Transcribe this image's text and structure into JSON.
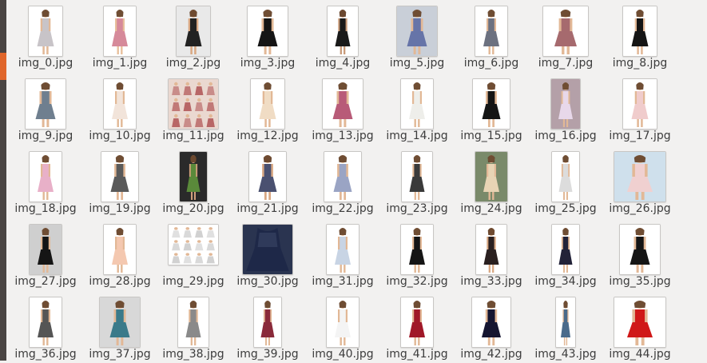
{
  "window": {
    "accent_color": "#e0662b",
    "launcher_color": "#4a4543",
    "background": "#f2f1f0"
  },
  "files": [
    {
      "name": "img_0.jpg",
      "bg": "#ffffff",
      "dress": "#c8c4c8",
      "skin": "#e2b896"
    },
    {
      "name": "img_1.jpg",
      "bg": "#ffffff",
      "dress": "#d68a9a",
      "skin": "#e8c09c"
    },
    {
      "name": "img_2.jpg",
      "bg": "#e9e9e9",
      "dress": "#222222",
      "skin": "#d9a883"
    },
    {
      "name": "img_3.jpg",
      "bg": "#ffffff",
      "dress": "#151515",
      "skin": "#e2b896"
    },
    {
      "name": "img_4.jpg",
      "bg": "#ffffff",
      "dress": "#1a1a1a",
      "skin": "#c89a78"
    },
    {
      "name": "img_5.jpg",
      "bg": "#c9cfd8",
      "dress": "#6674a8",
      "skin": "#e2b896"
    },
    {
      "name": "img_6.jpg",
      "bg": "#ffffff",
      "dress": "#6c7180",
      "skin": "#e2b896"
    },
    {
      "name": "img_7.jpg",
      "bg": "#ffffff",
      "dress": "#a66a6e",
      "skin": "#e2b896"
    },
    {
      "name": "img_8.jpg",
      "bg": "#ffffff",
      "dress": "#151515",
      "skin": "#e2b896"
    },
    {
      "name": "img_9.jpg",
      "bg": "#ffffff",
      "dress": "#6f7f8f",
      "skin": "#e2b896"
    },
    {
      "name": "img_10.jpg",
      "bg": "#ffffff",
      "dress": "#f2e4da",
      "skin": "#e2b896"
    },
    {
      "name": "img_11.jpg",
      "bg": "#ead8d0",
      "dress": "#b35a5a",
      "skin": "#e2b896"
    },
    {
      "name": "img_12.jpg",
      "bg": "#ffffff",
      "dress": "#f0dcc4",
      "skin": "#e2b896"
    },
    {
      "name": "img_13.jpg",
      "bg": "#ffffff",
      "dress": "#b85b78",
      "skin": "#e2b896"
    },
    {
      "name": "img_14.jpg",
      "bg": "#ffffff",
      "dress": "#eeeeea",
      "skin": "#e2b896"
    },
    {
      "name": "img_15.jpg",
      "bg": "#ffffff",
      "dress": "#151515",
      "skin": "#e2b896"
    },
    {
      "name": "img_16.jpg",
      "bg": "#b4a0a8",
      "dress": "#e8d8ea",
      "skin": "#e2b896"
    },
    {
      "name": "img_17.jpg",
      "bg": "#ffffff",
      "dress": "#f0cccc",
      "skin": "#e2b896"
    },
    {
      "name": "img_18.jpg",
      "bg": "#ffffff",
      "dress": "#e8b0c8",
      "skin": "#e2b896"
    },
    {
      "name": "img_19.jpg",
      "bg": "#ffffff",
      "dress": "#5a5a5a",
      "skin": "#e2b896"
    },
    {
      "name": "img_20.jpg",
      "bg": "#2a2a2a",
      "dress": "#5a8a3a",
      "skin": "#d2a07c"
    },
    {
      "name": "img_21.jpg",
      "bg": "#ffffff",
      "dress": "#4a5070",
      "skin": "#d9a883"
    },
    {
      "name": "img_22.jpg",
      "bg": "#ffffff",
      "dress": "#9aa4c4",
      "skin": "#e2b896"
    },
    {
      "name": "img_23.jpg",
      "bg": "#ffffff",
      "dress": "#3a3a3a",
      "skin": "#e2b896"
    },
    {
      "name": "img_24.jpg",
      "bg": "#7a8a6a",
      "dress": "#e8d4b4",
      "skin": "#e2b896"
    },
    {
      "name": "img_25.jpg",
      "bg": "#ffffff",
      "dress": "#dcdcdc",
      "skin": "#e2b896"
    },
    {
      "name": "img_26.jpg",
      "bg": "#cfe0ec",
      "dress": "#f0d0d0",
      "skin": "#e2b896"
    },
    {
      "name": "img_27.jpg",
      "bg": "#cfcfcf",
      "dress": "#151515",
      "skin": "#e2b896"
    },
    {
      "name": "img_28.jpg",
      "bg": "#ffffff",
      "dress": "#f4c8b0",
      "skin": "#e2b896"
    },
    {
      "name": "img_29.jpg",
      "bg": "#ffffff",
      "dress": "#cccccc",
      "skin": "#e2b896"
    },
    {
      "name": "img_30.jpg",
      "bg": "#2a3450",
      "dress": "#1e2848",
      "skin": "#1e2848"
    },
    {
      "name": "img_31.jpg",
      "bg": "#ffffff",
      "dress": "#c8d4e4",
      "skin": "#e2b896"
    },
    {
      "name": "img_32.jpg",
      "bg": "#ffffff",
      "dress": "#151515",
      "skin": "#e2b896"
    },
    {
      "name": "img_33.jpg",
      "bg": "#ffffff",
      "dress": "#2a2020",
      "skin": "#d9a883"
    },
    {
      "name": "img_34.jpg",
      "bg": "#ffffff",
      "dress": "#222238",
      "skin": "#e2b896"
    },
    {
      "name": "img_35.jpg",
      "bg": "#ffffff",
      "dress": "#151515",
      "skin": "#e2b896"
    },
    {
      "name": "img_36.jpg",
      "bg": "#ffffff",
      "dress": "#555555",
      "skin": "#e2b896"
    },
    {
      "name": "img_37.jpg",
      "bg": "#d8d8d8",
      "dress": "#3a7a8a",
      "skin": "#e2b896"
    },
    {
      "name": "img_38.jpg",
      "bg": "#ffffff",
      "dress": "#8a8a8a",
      "skin": "#e2b896"
    },
    {
      "name": "img_39.jpg",
      "bg": "#ffffff",
      "dress": "#8a2a3a",
      "skin": "#e2b896"
    },
    {
      "name": "img_40.jpg",
      "bg": "#ffffff",
      "dress": "#f4f4f4",
      "skin": "#e2b896"
    },
    {
      "name": "img_41.jpg",
      "bg": "#ffffff",
      "dress": "#a01828",
      "skin": "#e2b896"
    },
    {
      "name": "img_42.jpg",
      "bg": "#ffffff",
      "dress": "#151530",
      "skin": "#e2b896"
    },
    {
      "name": "img_43.jpg",
      "bg": "#ffffff",
      "dress": "#4a6a8a",
      "skin": "#e2b896"
    },
    {
      "name": "img_44.jpg",
      "bg": "#ffffff",
      "dress": "#d01818",
      "skin": "#e2b896"
    }
  ]
}
